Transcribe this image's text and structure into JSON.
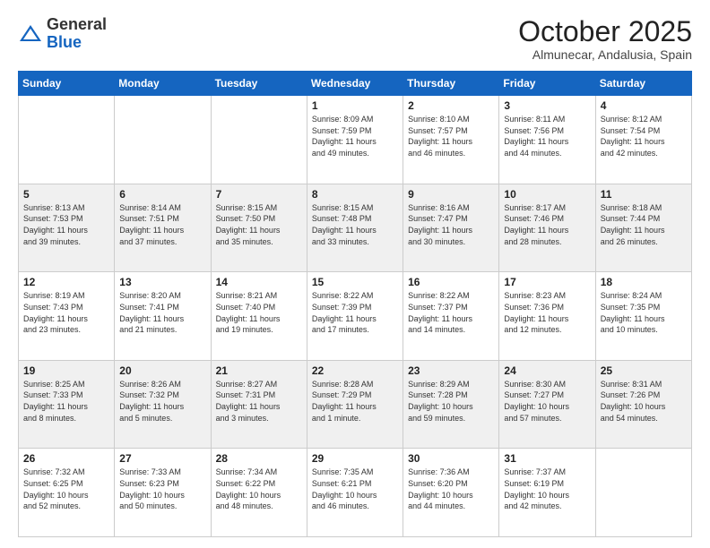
{
  "header": {
    "logo_general": "General",
    "logo_blue": "Blue",
    "month_title": "October 2025",
    "location": "Almunecar, Andalusia, Spain"
  },
  "weekdays": [
    "Sunday",
    "Monday",
    "Tuesday",
    "Wednesday",
    "Thursday",
    "Friday",
    "Saturday"
  ],
  "weeks": [
    [
      {
        "day": "",
        "info": ""
      },
      {
        "day": "",
        "info": ""
      },
      {
        "day": "",
        "info": ""
      },
      {
        "day": "1",
        "info": "Sunrise: 8:09 AM\nSunset: 7:59 PM\nDaylight: 11 hours\nand 49 minutes."
      },
      {
        "day": "2",
        "info": "Sunrise: 8:10 AM\nSunset: 7:57 PM\nDaylight: 11 hours\nand 46 minutes."
      },
      {
        "day": "3",
        "info": "Sunrise: 8:11 AM\nSunset: 7:56 PM\nDaylight: 11 hours\nand 44 minutes."
      },
      {
        "day": "4",
        "info": "Sunrise: 8:12 AM\nSunset: 7:54 PM\nDaylight: 11 hours\nand 42 minutes."
      }
    ],
    [
      {
        "day": "5",
        "info": "Sunrise: 8:13 AM\nSunset: 7:53 PM\nDaylight: 11 hours\nand 39 minutes."
      },
      {
        "day": "6",
        "info": "Sunrise: 8:14 AM\nSunset: 7:51 PM\nDaylight: 11 hours\nand 37 minutes."
      },
      {
        "day": "7",
        "info": "Sunrise: 8:15 AM\nSunset: 7:50 PM\nDaylight: 11 hours\nand 35 minutes."
      },
      {
        "day": "8",
        "info": "Sunrise: 8:15 AM\nSunset: 7:48 PM\nDaylight: 11 hours\nand 33 minutes."
      },
      {
        "day": "9",
        "info": "Sunrise: 8:16 AM\nSunset: 7:47 PM\nDaylight: 11 hours\nand 30 minutes."
      },
      {
        "day": "10",
        "info": "Sunrise: 8:17 AM\nSunset: 7:46 PM\nDaylight: 11 hours\nand 28 minutes."
      },
      {
        "day": "11",
        "info": "Sunrise: 8:18 AM\nSunset: 7:44 PM\nDaylight: 11 hours\nand 26 minutes."
      }
    ],
    [
      {
        "day": "12",
        "info": "Sunrise: 8:19 AM\nSunset: 7:43 PM\nDaylight: 11 hours\nand 23 minutes."
      },
      {
        "day": "13",
        "info": "Sunrise: 8:20 AM\nSunset: 7:41 PM\nDaylight: 11 hours\nand 21 minutes."
      },
      {
        "day": "14",
        "info": "Sunrise: 8:21 AM\nSunset: 7:40 PM\nDaylight: 11 hours\nand 19 minutes."
      },
      {
        "day": "15",
        "info": "Sunrise: 8:22 AM\nSunset: 7:39 PM\nDaylight: 11 hours\nand 17 minutes."
      },
      {
        "day": "16",
        "info": "Sunrise: 8:22 AM\nSunset: 7:37 PM\nDaylight: 11 hours\nand 14 minutes."
      },
      {
        "day": "17",
        "info": "Sunrise: 8:23 AM\nSunset: 7:36 PM\nDaylight: 11 hours\nand 12 minutes."
      },
      {
        "day": "18",
        "info": "Sunrise: 8:24 AM\nSunset: 7:35 PM\nDaylight: 11 hours\nand 10 minutes."
      }
    ],
    [
      {
        "day": "19",
        "info": "Sunrise: 8:25 AM\nSunset: 7:33 PM\nDaylight: 11 hours\nand 8 minutes."
      },
      {
        "day": "20",
        "info": "Sunrise: 8:26 AM\nSunset: 7:32 PM\nDaylight: 11 hours\nand 5 minutes."
      },
      {
        "day": "21",
        "info": "Sunrise: 8:27 AM\nSunset: 7:31 PM\nDaylight: 11 hours\nand 3 minutes."
      },
      {
        "day": "22",
        "info": "Sunrise: 8:28 AM\nSunset: 7:29 PM\nDaylight: 11 hours\nand 1 minute."
      },
      {
        "day": "23",
        "info": "Sunrise: 8:29 AM\nSunset: 7:28 PM\nDaylight: 10 hours\nand 59 minutes."
      },
      {
        "day": "24",
        "info": "Sunrise: 8:30 AM\nSunset: 7:27 PM\nDaylight: 10 hours\nand 57 minutes."
      },
      {
        "day": "25",
        "info": "Sunrise: 8:31 AM\nSunset: 7:26 PM\nDaylight: 10 hours\nand 54 minutes."
      }
    ],
    [
      {
        "day": "26",
        "info": "Sunrise: 7:32 AM\nSunset: 6:25 PM\nDaylight: 10 hours\nand 52 minutes."
      },
      {
        "day": "27",
        "info": "Sunrise: 7:33 AM\nSunset: 6:23 PM\nDaylight: 10 hours\nand 50 minutes."
      },
      {
        "day": "28",
        "info": "Sunrise: 7:34 AM\nSunset: 6:22 PM\nDaylight: 10 hours\nand 48 minutes."
      },
      {
        "day": "29",
        "info": "Sunrise: 7:35 AM\nSunset: 6:21 PM\nDaylight: 10 hours\nand 46 minutes."
      },
      {
        "day": "30",
        "info": "Sunrise: 7:36 AM\nSunset: 6:20 PM\nDaylight: 10 hours\nand 44 minutes."
      },
      {
        "day": "31",
        "info": "Sunrise: 7:37 AM\nSunset: 6:19 PM\nDaylight: 10 hours\nand 42 minutes."
      },
      {
        "day": "",
        "info": ""
      }
    ]
  ]
}
